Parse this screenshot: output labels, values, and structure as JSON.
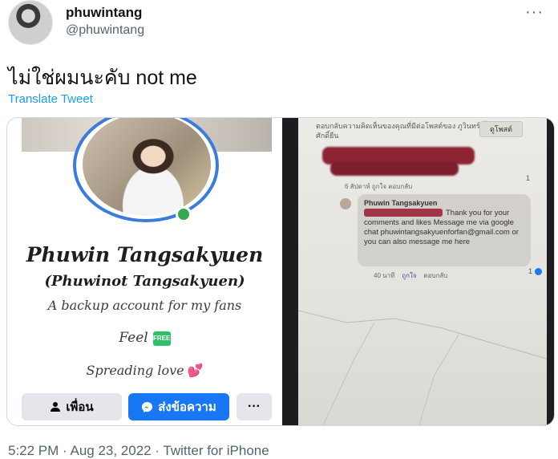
{
  "tweet": {
    "display_name": "phuwintang",
    "handle": "@phuwintang",
    "more": "···",
    "text": "ไม่ใช่ผมนะคับ not me",
    "translate": "Translate Tweet",
    "footer": "5:22 PM · Aug 23, 2022 · Twitter for iPhone"
  },
  "facebook_card": {
    "name": "Phuwin Tangsakyuen",
    "alt_name": "(Phuwinot Tangsakyuen)",
    "bio": "A backup account for my fans",
    "feel": "Feel",
    "free_badge": "FREE",
    "love": "Spreading love",
    "hearts": "💕",
    "friend_button": "เพื่อน",
    "message_button": "ส่งข้อความ",
    "more_button": "···"
  },
  "phone_screenshot": {
    "header_text": "ตอบกลับความคิดเห็นของคุณที่มีต่อโพสต์ของ ภูวินทร์ ตั้งศักดิ์ยืน",
    "share_button": "ดูโพสต์",
    "comment_meta": "6 สัปดาห์   ถูกใจ   ตอบกลับ",
    "comment_count": "1",
    "reply_name": "Phuwin Tangsakyuen",
    "reply_text": "Thank you for your comments and likes Message me via google chat phuwintangsakyuenforfan@gmail.com or you can also message me here",
    "reply_meta_time": "40 นาที",
    "reply_meta_like": "ถูกใจ",
    "reply_meta_reply": "ตอบกลับ",
    "reply_likes": "1"
  },
  "colors": {
    "twitter_blue": "#1d9bf0",
    "facebook_blue": "#1877f2",
    "online_green": "#36a852"
  }
}
